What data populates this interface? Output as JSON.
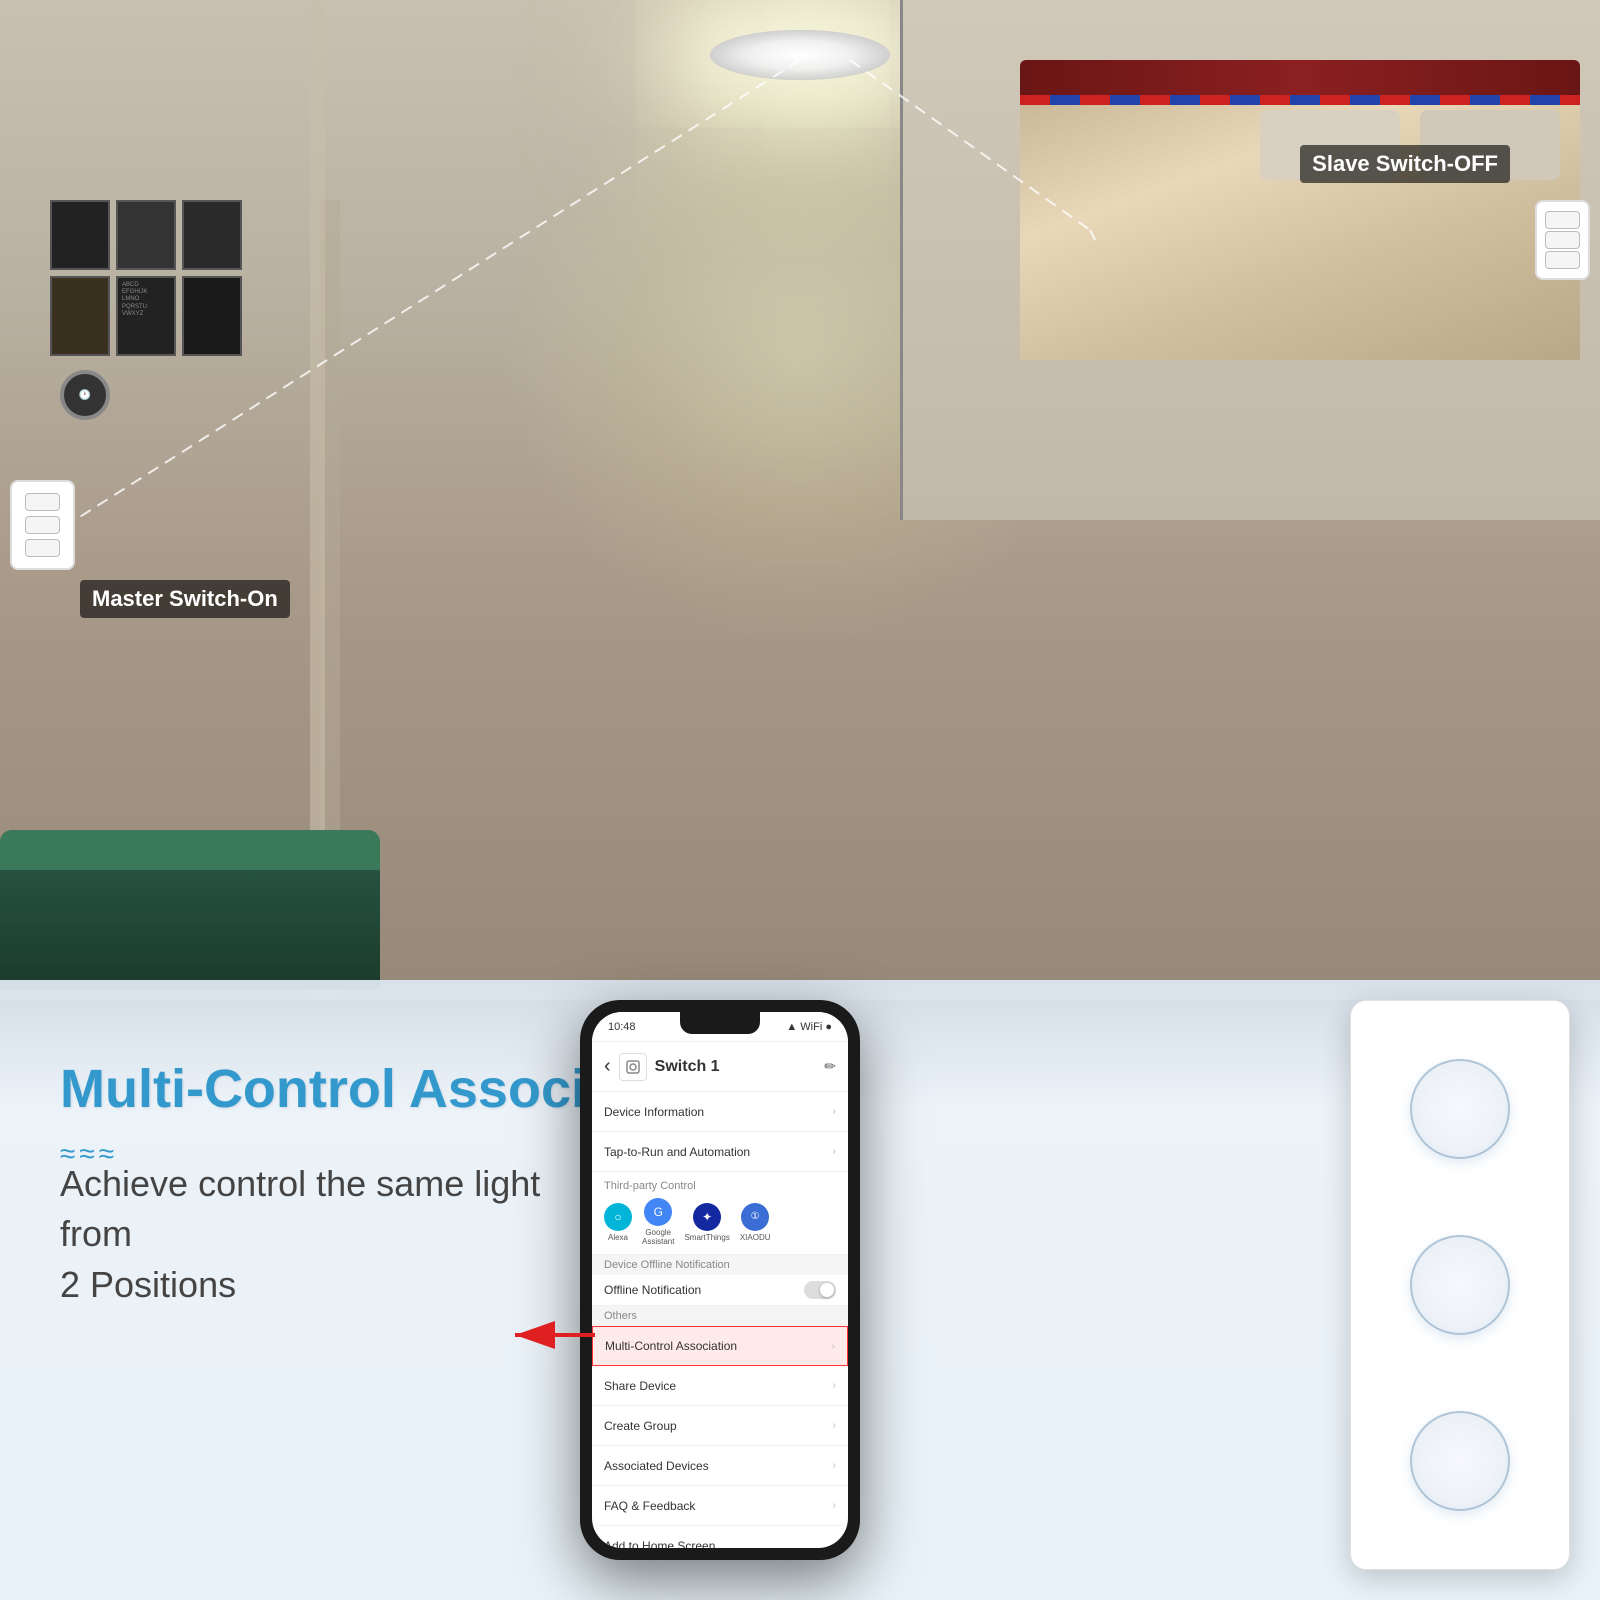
{
  "scene": {
    "labels": {
      "master_switch": "Master Switch-On",
      "slave_switch": "Slave Switch-OFF",
      "feature_title": "Multi-Control Association",
      "wave": "≈≈≈",
      "feature_desc": "Achieve control the same light from\n2 Positions"
    },
    "time": "10:48",
    "signal": "●●●"
  },
  "phone": {
    "header": {
      "back": "‹",
      "title": "Switch 1",
      "edit": "✏"
    },
    "menu_items": [
      {
        "id": "device-info",
        "label": "Device Information",
        "has_arrow": true
      },
      {
        "id": "tap-run",
        "label": "Tap-to-Run and Automation",
        "has_arrow": true
      }
    ],
    "third_party": {
      "section_label": "Third-party Control",
      "services": [
        {
          "id": "alexa",
          "label": "Alexa",
          "symbol": "○",
          "color_class": "alexa-color"
        },
        {
          "id": "google",
          "label": "Google\nAssistant",
          "symbol": "G",
          "color_class": "google-color"
        },
        {
          "id": "smartthings",
          "label": "SmartThings",
          "symbol": "✦",
          "color_class": "smartthings-color"
        },
        {
          "id": "xiaodu",
          "label": "XIAODU",
          "symbol": "①",
          "color_class": "xiaodu-color"
        }
      ]
    },
    "offline_section": {
      "header": "Device Offline Notification",
      "toggle_label": "Offline Notification",
      "toggle_state": "off"
    },
    "others_section": {
      "header": "Others",
      "items": [
        {
          "id": "multi-control",
          "label": "Multi-Control Association",
          "highlighted": true,
          "has_arrow": true
        },
        {
          "id": "share-device",
          "label": "Share Device",
          "has_arrow": true
        },
        {
          "id": "create-group",
          "label": "Create Group",
          "has_arrow": true
        },
        {
          "id": "associated-devices",
          "label": "Associated Devices",
          "has_arrow": true
        },
        {
          "id": "faq",
          "label": "FAQ & Feedback",
          "has_arrow": true
        },
        {
          "id": "add-home",
          "label": "Add to Home Screen",
          "has_arrow": true
        }
      ]
    }
  }
}
